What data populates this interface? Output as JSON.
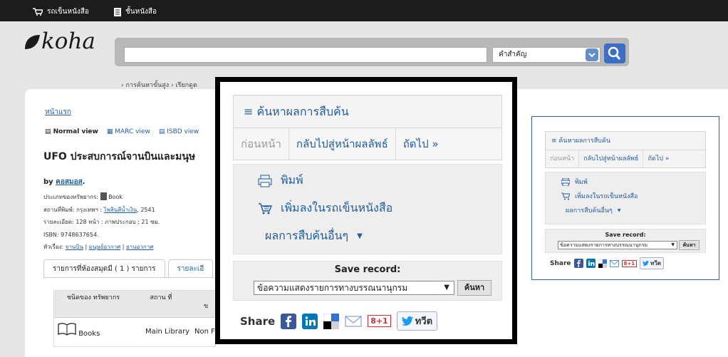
{
  "topbar": {
    "cart_label": "รถเข็นหนังสือ",
    "lists_label": "ชั้นหนังสือ"
  },
  "logo": {
    "text": "koha"
  },
  "search": {
    "value": "",
    "type_selected": "คำสำคัญ",
    "links": "› การค้นหาขั้นสูง   › เรียกดูต"
  },
  "breadcrumb": {
    "home": "หน้าแรก"
  },
  "views": {
    "normal": "Normal view",
    "marc": "MARC view",
    "isbd": "ISBD view"
  },
  "record": {
    "title": "UFO ประสบการณ์จานบินและมนุษ",
    "by_label": "by",
    "author": "คอสมอส",
    "author_suffix": ".",
    "material_type_label": "ประเภทของทรัพยากร:",
    "material_type": "Book",
    "publisher_label": "สถานที่พิมพ์: กรุงเทพฯ : ",
    "publisher": "ไพลินสีน้ำเงิน",
    "publisher_year": ", 2541",
    "description": "รายละเอียด: 128 หน้า : ภาพประกอบ ; 21 ซม.",
    "isbn": "ISBN: 9748637654.",
    "subjects_label": "หัวเรื่อง:",
    "subject_1": "จานบิน",
    "subject_2": "มนุษย์อวกาศ",
    "subject_3": "ยานอวกาศ"
  },
  "tabs": {
    "holdings": "รายการที่ห้องสมุดมี ( 1 ) รายการ",
    "details": "รายละเอี"
  },
  "holdings_table": {
    "headers": [
      "ชนิดของ ทรัพยากร",
      "สถาน ที่",
      "ข"
    ],
    "row": {
      "type": "Books",
      "location": "Main Library",
      "collection": "Non F"
    }
  },
  "sidebar": {
    "heading": "ค้นหาผลการสืบค้น",
    "prev": "ก่อนหน้า",
    "back": "กลับไปสู่หน้าผลลัพธ์",
    "next": "ถัดไป »",
    "print": "พิมพ์",
    "add_cart": "เพิ่มลงในรถเข็นหนังสือ",
    "more_searches": "ผลการสืบค้นอื่นๆ",
    "save_label": "Save record:",
    "save_format": "ข้อความแสดงรายการทางบรรณนานุกรม",
    "save_button": "ค้นหา",
    "share_label": "Share",
    "tweet": "ทวีต",
    "gplus": "8+1"
  },
  "colors": {
    "accent": "#235d9e",
    "frame": "#000000",
    "twitter": "#1d9bf0",
    "facebook": "#3b5998",
    "linkedin": "#0077b5"
  }
}
